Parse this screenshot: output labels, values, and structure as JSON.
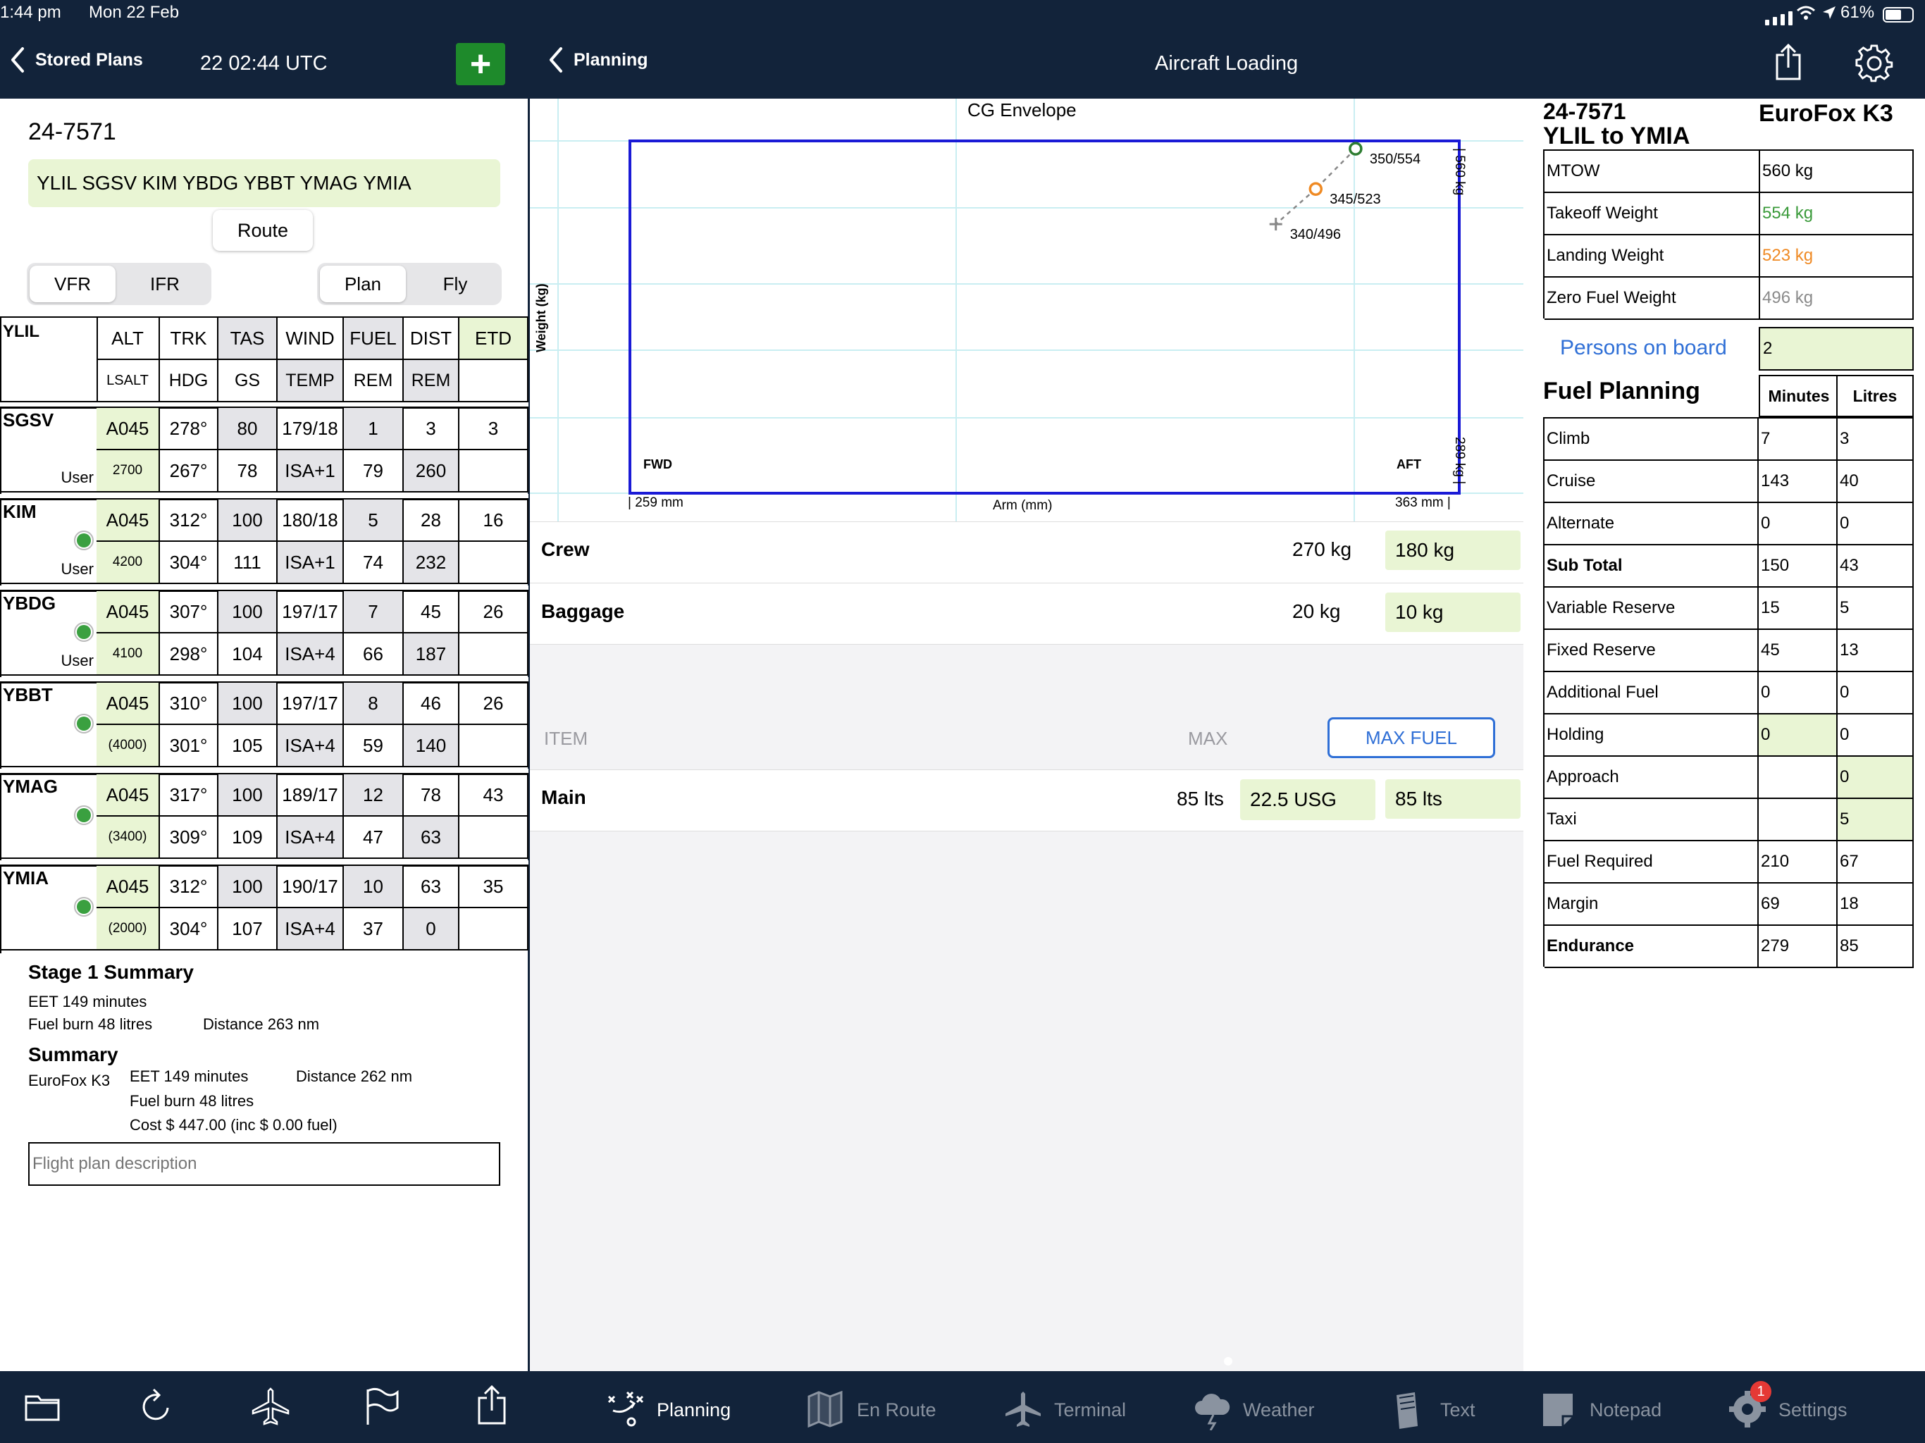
{
  "status": {
    "time": "1:44 pm",
    "date": "Mon 22 Feb",
    "battery": "61%"
  },
  "left": {
    "back_label": "Stored Plans",
    "utc_time": "22 02:44 UTC",
    "add_label": "+",
    "plan_id": "24-7571",
    "route_text": "YLIL SGSV KIM YBDG YBBT YMAG YMIA",
    "route_button": "Route",
    "rules_seg": [
      "VFR",
      "IFR"
    ],
    "mode_seg": [
      "Plan",
      "Fly"
    ],
    "origin": "YLIL",
    "hdr1": [
      "ALT",
      "TRK",
      "TAS",
      "WIND",
      "FUEL",
      "DIST",
      "ETD"
    ],
    "hdr2": [
      "LSALT",
      "HDG",
      "GS",
      "TEMP",
      "REM",
      "REM",
      ""
    ],
    "legs": [
      {
        "name": "SGSV",
        "tag": "User",
        "dot": false,
        "r1": [
          "A045",
          "278°",
          "80",
          "179/18",
          "1",
          "3",
          "3"
        ],
        "r2": [
          "2700",
          "267°",
          "78",
          "ISA+1",
          "79",
          "260",
          ""
        ]
      },
      {
        "name": "KIM",
        "tag": "User",
        "dot": true,
        "r1": [
          "A045",
          "312°",
          "100",
          "180/18",
          "5",
          "28",
          "16"
        ],
        "r2": [
          "4200",
          "304°",
          "111",
          "ISA+1",
          "74",
          "232",
          ""
        ]
      },
      {
        "name": "YBDG",
        "tag": "User",
        "dot": true,
        "r1": [
          "A045",
          "307°",
          "100",
          "197/17",
          "7",
          "45",
          "26"
        ],
        "r2": [
          "4100",
          "298°",
          "104",
          "ISA+4",
          "66",
          "187",
          ""
        ]
      },
      {
        "name": "YBBT",
        "tag": "",
        "dot": true,
        "r1": [
          "A045",
          "310°",
          "100",
          "197/17",
          "8",
          "46",
          "26"
        ],
        "r2": [
          "(4000)",
          "301°",
          "105",
          "ISA+4",
          "59",
          "140",
          ""
        ]
      },
      {
        "name": "YMAG",
        "tag": "",
        "dot": true,
        "r1": [
          "A045",
          "317°",
          "100",
          "189/17",
          "12",
          "78",
          "43"
        ],
        "r2": [
          "(3400)",
          "309°",
          "109",
          "ISA+4",
          "47",
          "63",
          ""
        ]
      },
      {
        "name": "YMIA",
        "tag": "",
        "dot": true,
        "r1": [
          "A045",
          "312°",
          "100",
          "190/17",
          "10",
          "63",
          "35"
        ],
        "r2": [
          "(2000)",
          "304°",
          "107",
          "ISA+4",
          "37",
          "0",
          ""
        ]
      }
    ],
    "stage_title": "Stage 1 Summary",
    "stage_eet": "EET 149 minutes",
    "stage_fuel": "Fuel burn 48 litres",
    "stage_dist": "Distance 263 nm",
    "summary_title": "Summary",
    "summary_aircraft": "EuroFox K3",
    "summary_eet": "EET 149 minutes",
    "summary_dist": "Distance 262 nm",
    "summary_fuel": "Fuel burn 48 litres",
    "summary_cost": "Cost $ 447.00 (inc $ 0.00 fuel)",
    "desc_placeholder": "Flight plan description"
  },
  "center": {
    "back_label": "Planning",
    "title": "Aircraft Loading",
    "cg": {
      "title": "CG Envelope",
      "xlabel": "Arm (mm)",
      "ylabel": "Weight (kg)",
      "fwd": "FWD",
      "aft": "AFT",
      "arm_min": "| 259 mm",
      "arm_max": "363 mm |",
      "w_max": "| 560 kg",
      "w_min": "289 kg |",
      "points": [
        {
          "label": "350/554",
          "arm": 350,
          "weight": 554,
          "color": "#2e7d32",
          "marker": "circle"
        },
        {
          "label": "345/523",
          "arm": 345,
          "weight": 523,
          "color": "#ef8a24",
          "marker": "circle"
        },
        {
          "label": "340/496",
          "arm": 340,
          "weight": 496,
          "color": "#888888",
          "marker": "plus"
        }
      ]
    },
    "crew": {
      "label": "Crew",
      "max": "270 kg",
      "value": "180 kg"
    },
    "baggage": {
      "label": "Baggage",
      "max": "20 kg",
      "value": "10 kg"
    },
    "fuel_hdr": {
      "item": "ITEM",
      "max": "MAX",
      "btn": "MAX FUEL"
    },
    "main": {
      "label": "Main",
      "max": "85 lts",
      "usg": "22.5 USG",
      "lts": "85 lts"
    }
  },
  "right": {
    "plan_id": "24-7571",
    "aircraft": "EuroFox K3",
    "route": "YLIL to YMIA",
    "weights": [
      {
        "label": "MTOW",
        "value": "560 kg",
        "color": "#000000"
      },
      {
        "label": "Takeoff Weight",
        "value": "554 kg",
        "color": "#3a9a3a"
      },
      {
        "label": "Landing Weight",
        "value": "523 kg",
        "color": "#ef8a24"
      },
      {
        "label": "Zero Fuel Weight",
        "value": "496 kg",
        "color": "#8a8a8a"
      }
    ],
    "pob_label": "Persons on board",
    "pob_value": "2",
    "fuel_title": "Fuel Planning",
    "fuel_cols": [
      "Minutes",
      "Litres"
    ],
    "fuel_rows": [
      {
        "label": "Climb",
        "min": "7",
        "lit": "3",
        "bold": false,
        "gm": false,
        "gl": false
      },
      {
        "label": "Cruise",
        "min": "143",
        "lit": "40",
        "bold": false,
        "gm": false,
        "gl": false
      },
      {
        "label": "Alternate",
        "min": "0",
        "lit": "0",
        "bold": false,
        "gm": false,
        "gl": false
      },
      {
        "label": "Sub Total",
        "min": "150",
        "lit": "43",
        "bold": true,
        "gm": false,
        "gl": false
      },
      {
        "label": "Variable Reserve",
        "min": "15",
        "lit": "5",
        "bold": false,
        "gm": false,
        "gl": false
      },
      {
        "label": "Fixed Reserve",
        "min": "45",
        "lit": "13",
        "bold": false,
        "gm": false,
        "gl": false
      },
      {
        "label": "Additional Fuel",
        "min": "0",
        "lit": "0",
        "bold": false,
        "gm": false,
        "gl": false
      },
      {
        "label": "Holding",
        "min": "0",
        "lit": "0",
        "bold": false,
        "gm": true,
        "gl": false
      },
      {
        "label": "Approach",
        "min": "",
        "lit": "0",
        "bold": false,
        "gm": false,
        "gl": true
      },
      {
        "label": "Taxi",
        "min": "",
        "lit": "5",
        "bold": false,
        "gm": false,
        "gl": true
      },
      {
        "label": "Fuel Required",
        "min": "210",
        "lit": "67",
        "bold": false,
        "gm": false,
        "gl": false
      },
      {
        "label": "Margin",
        "min": "69",
        "lit": "18",
        "bold": false,
        "gm": false,
        "gl": false
      },
      {
        "label": "Endurance",
        "min": "279",
        "lit": "85",
        "bold": true,
        "gm": false,
        "gl": false
      }
    ]
  },
  "tabs": [
    {
      "label": "Planning",
      "icon": "planning-icon",
      "active": true
    },
    {
      "label": "En Route",
      "icon": "map-icon",
      "active": false
    },
    {
      "label": "Terminal",
      "icon": "airplane-icon",
      "active": false
    },
    {
      "label": "Weather",
      "icon": "weather-icon",
      "active": false
    },
    {
      "label": "Text",
      "icon": "text-icon",
      "active": false
    },
    {
      "label": "Notepad",
      "icon": "notepad-icon",
      "active": false
    },
    {
      "label": "Settings",
      "icon": "settings-icon",
      "active": false,
      "badge": "1"
    }
  ],
  "colors": {
    "nav": "#12233a",
    "accent": "#1e8a2b",
    "highlight": "#e9f5d4",
    "envelope": "#1a1ad6",
    "link": "#2f6fd6"
  }
}
